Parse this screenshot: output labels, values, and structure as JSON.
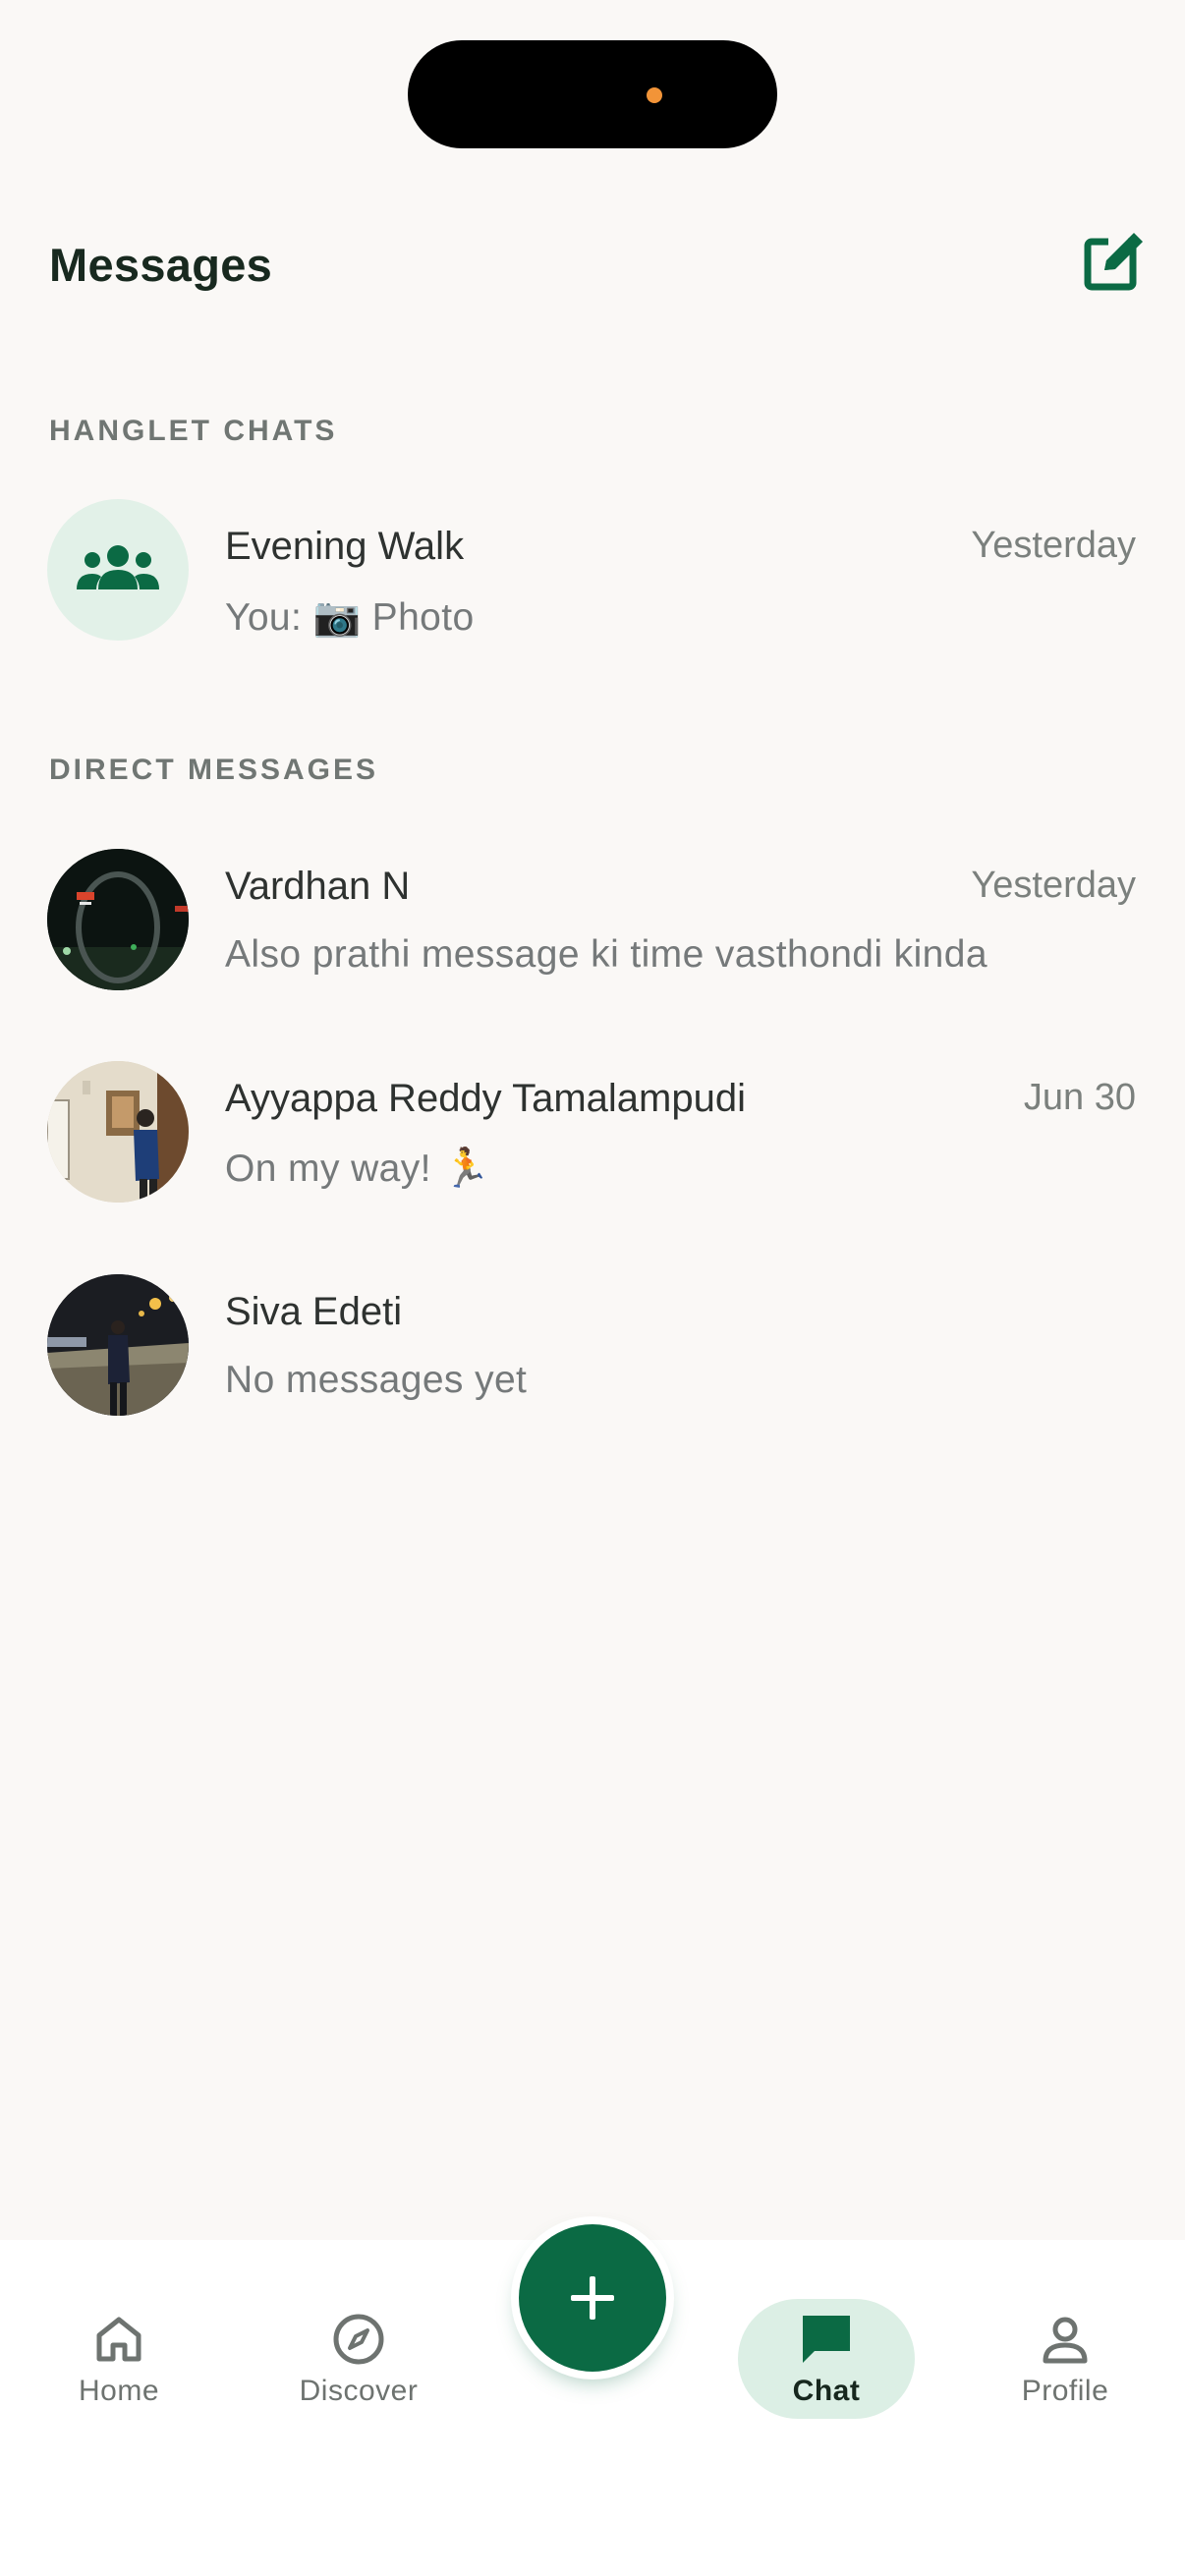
{
  "header": {
    "title": "Messages"
  },
  "sections": {
    "hanglet": "HANGLET CHATS",
    "direct": "DIRECT MESSAGES"
  },
  "hanglet_chats": [
    {
      "name": "Evening Walk",
      "preview": "You: 📷  Photo",
      "time": "Yesterday"
    }
  ],
  "direct_messages": [
    {
      "name": "Vardhan N",
      "preview": "Also prathi message ki time vasthondi kinda",
      "time": "Yesterday"
    },
    {
      "name": "Ayyappa Reddy Tamalampudi",
      "preview": "On my way! 🏃",
      "time": "Jun 30"
    },
    {
      "name": "Siva Edeti",
      "preview": "No messages yet",
      "time": ""
    }
  ],
  "nav": {
    "home": "Home",
    "discover": "Discover",
    "chat": "Chat",
    "profile": "Profile"
  },
  "colors": {
    "brand": "#0b6a44",
    "active_pill": "#dcefe5",
    "background": "#faf8f6"
  }
}
